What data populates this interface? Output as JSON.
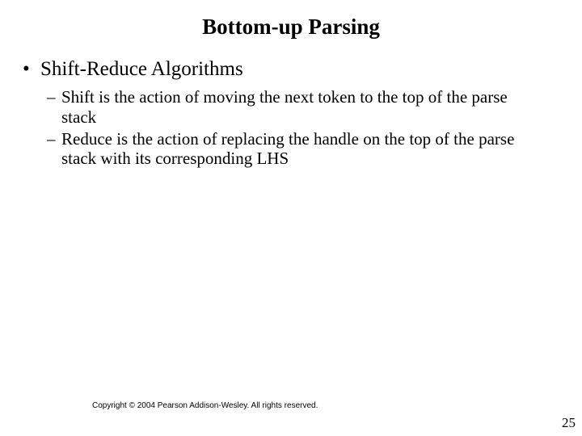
{
  "title": "Bottom-up Parsing",
  "l1": {
    "bullet": "•",
    "text": "Shift-Reduce Algorithms"
  },
  "l2": {
    "dash": "–",
    "items": [
      "Shift is the action of moving the next token to the top of the parse stack",
      "Reduce is the action of replacing the handle on the top of the parse stack with its corresponding LHS"
    ]
  },
  "copyright": "Copyright © 2004 Pearson Addison-Wesley. All rights reserved.",
  "pagenum": "25"
}
